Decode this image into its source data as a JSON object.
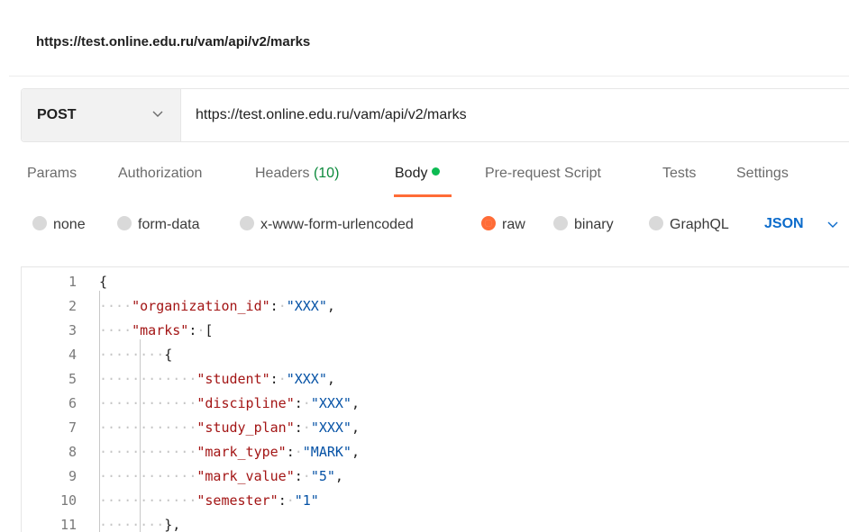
{
  "top_url": "https://test.online.edu.ru/vam/api/v2/marks",
  "request": {
    "method": "POST",
    "url": "https://test.online.edu.ru/vam/api/v2/marks"
  },
  "tabs": [
    {
      "label": "Params"
    },
    {
      "label": "Authorization"
    },
    {
      "label": "Headers",
      "count": "(10)"
    },
    {
      "label": "Body",
      "active": true
    },
    {
      "label": "Pre-request Script"
    },
    {
      "label": "Tests"
    },
    {
      "label": "Settings"
    }
  ],
  "body_types": [
    {
      "label": "none"
    },
    {
      "label": "form-data"
    },
    {
      "label": "x-www-form-urlencoded"
    },
    {
      "label": "raw",
      "selected": true
    },
    {
      "label": "binary"
    },
    {
      "label": "GraphQL"
    }
  ],
  "language": "JSON",
  "code_lines": [
    {
      "num": "1",
      "ws": "",
      "tokens": [
        [
          "punc",
          "{"
        ]
      ]
    },
    {
      "num": "2",
      "ws": "····",
      "tokens": [
        [
          "key",
          "\"organization_id\""
        ],
        [
          "punc",
          ":"
        ],
        [
          "ws",
          "·"
        ],
        [
          "str",
          "\"XXX\""
        ],
        [
          "punc",
          ","
        ]
      ]
    },
    {
      "num": "3",
      "ws": "····",
      "tokens": [
        [
          "key",
          "\"marks\""
        ],
        [
          "punc",
          ":"
        ],
        [
          "ws",
          "·"
        ],
        [
          "punc",
          "["
        ]
      ]
    },
    {
      "num": "4",
      "ws": "········",
      "tokens": [
        [
          "punc",
          "{"
        ]
      ]
    },
    {
      "num": "5",
      "ws": "············",
      "tokens": [
        [
          "key",
          "\"student\""
        ],
        [
          "punc",
          ":"
        ],
        [
          "ws",
          "·"
        ],
        [
          "str",
          "\"XXX\""
        ],
        [
          "punc",
          ","
        ]
      ]
    },
    {
      "num": "6",
      "ws": "············",
      "tokens": [
        [
          "key",
          "\"discipline\""
        ],
        [
          "punc",
          ":"
        ],
        [
          "ws",
          "·"
        ],
        [
          "str",
          "\"XXX\""
        ],
        [
          "punc",
          ","
        ]
      ]
    },
    {
      "num": "7",
      "ws": "············",
      "tokens": [
        [
          "key",
          "\"study_plan\""
        ],
        [
          "punc",
          ":"
        ],
        [
          "ws",
          "·"
        ],
        [
          "str",
          "\"XXX\""
        ],
        [
          "punc",
          ","
        ]
      ]
    },
    {
      "num": "8",
      "ws": "············",
      "tokens": [
        [
          "key",
          "\"mark_type\""
        ],
        [
          "punc",
          ":"
        ],
        [
          "ws",
          "·"
        ],
        [
          "str",
          "\"MARK\""
        ],
        [
          "punc",
          ","
        ]
      ]
    },
    {
      "num": "9",
      "ws": "············",
      "tokens": [
        [
          "key",
          "\"mark_value\""
        ],
        [
          "punc",
          ":"
        ],
        [
          "ws",
          "·"
        ],
        [
          "str",
          "\"5\""
        ],
        [
          "punc",
          ","
        ]
      ]
    },
    {
      "num": "10",
      "ws": "············",
      "tokens": [
        [
          "key",
          "\"semester\""
        ],
        [
          "punc",
          ":"
        ],
        [
          "ws",
          "·"
        ],
        [
          "str",
          "\"1\""
        ]
      ]
    },
    {
      "num": "11",
      "ws": "········",
      "tokens": [
        [
          "punc",
          "},"
        ]
      ]
    }
  ],
  "colors": {
    "accent_orange": "#ff6c37",
    "active_dot_green": "#0cbb52",
    "json_key": "#a31515",
    "json_string": "#0451a5",
    "language_blue": "#0b6bcb"
  },
  "icons": {
    "method_dropdown": "chevron-down-icon",
    "language_dropdown": "chevron-down-icon"
  }
}
